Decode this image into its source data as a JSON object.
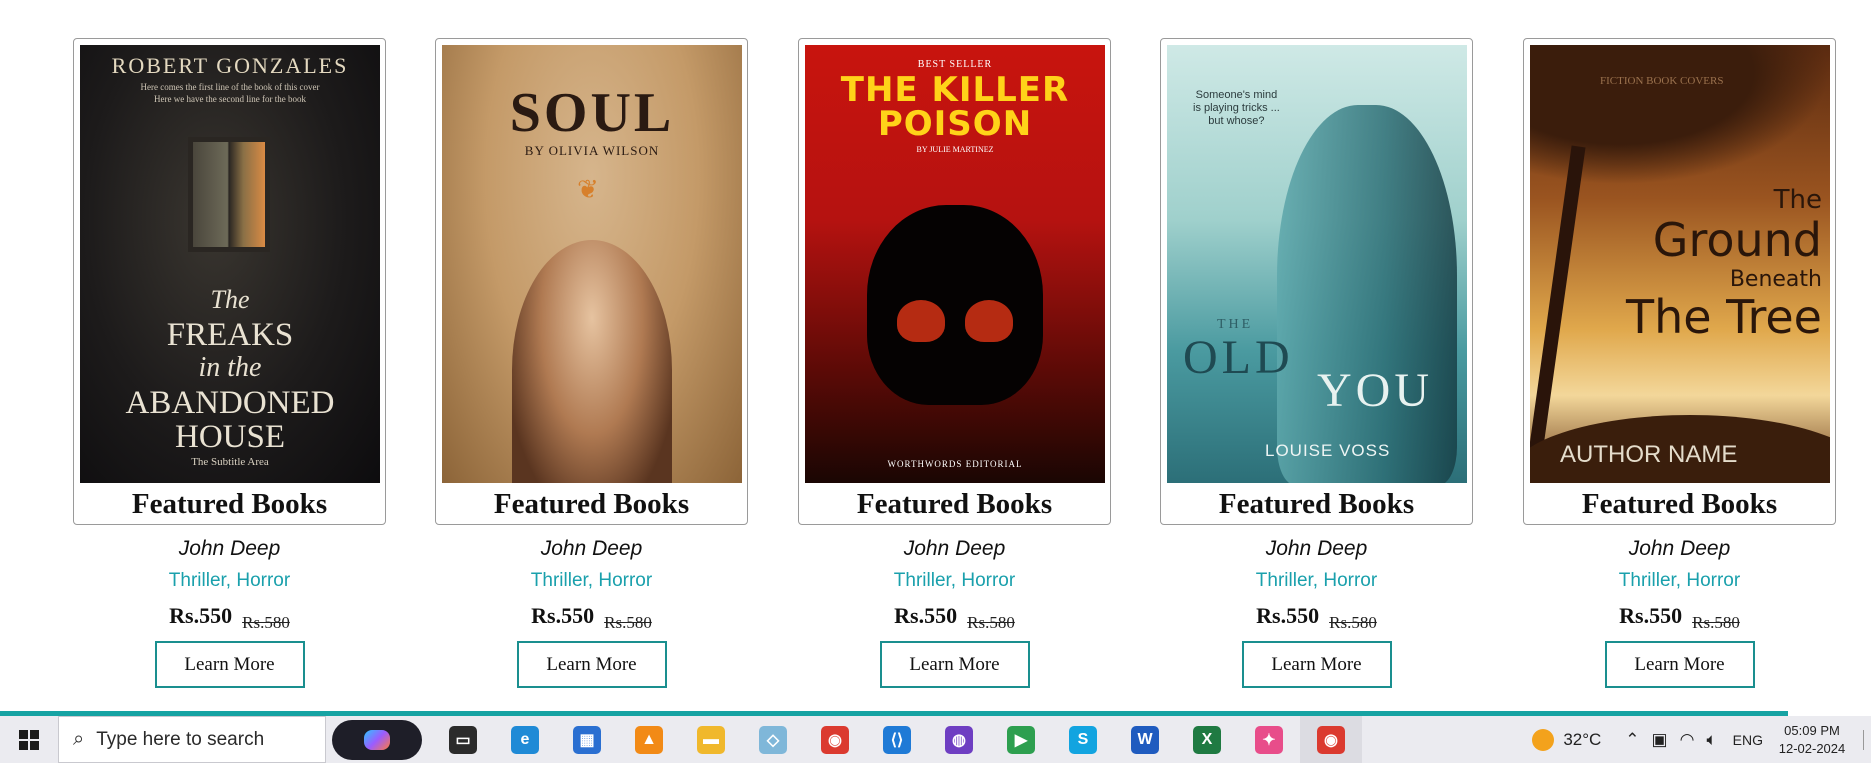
{
  "books": [
    {
      "heading": "Featured Books",
      "author": "John Deep",
      "genre": "Thriller, Horror",
      "price": "Rs.550",
      "old_price": "Rs.580",
      "button": "Learn More",
      "cover": {
        "author": "ROBERT GONZALES",
        "tagline_1": "Here comes the first line of the book of this cover",
        "tagline_2": "Here we have the second line for the book",
        "the": "The",
        "line_1": "FREAKS",
        "line_2": "in the",
        "line_3": "ABANDONED",
        "line_4": "HOUSE",
        "subtitle": "The Subtitle Area"
      }
    },
    {
      "heading": "Featured Books",
      "author": "John Deep",
      "genre": "Thriller, Horror",
      "price": "Rs.550",
      "old_price": "Rs.580",
      "button": "Learn More",
      "cover": {
        "title": "SOUL",
        "byline": "BY OLIVIA WILSON"
      }
    },
    {
      "heading": "Featured Books",
      "author": "John Deep",
      "genre": "Thriller, Horror",
      "price": "Rs.550",
      "old_price": "Rs.580",
      "button": "Learn More",
      "cover": {
        "badge": "BEST SELLER",
        "title_1": "THE KILLER",
        "title_2": "POISON",
        "byline": "BY JULIE MARTINEZ",
        "publisher": "WORTHWORDS EDITORIAL"
      }
    },
    {
      "heading": "Featured Books",
      "author": "John Deep",
      "genre": "Thriller, Horror",
      "price": "Rs.550",
      "old_price": "Rs.580",
      "button": "Learn More",
      "cover": {
        "quote_1": "Someone's mind",
        "quote_2": "is playing tricks ...",
        "quote_3": "but whose?",
        "the": "THE",
        "old": "OLD",
        "you": "YOU",
        "author": "LOUISE VOSS"
      }
    },
    {
      "heading": "Featured Books",
      "author": "John Deep",
      "genre": "Thriller, Horror",
      "price": "Rs.550",
      "old_price": "Rs.580",
      "button": "Learn More",
      "cover": {
        "the": "The",
        "ground": "Ground",
        "beneath": "Beneath",
        "tree": "The Tree",
        "author": "AUTHOR NAME",
        "watermark": "FICTION BOOK COVERS"
      }
    }
  ],
  "taskbar": {
    "search_placeholder": "Type here to search",
    "apps": [
      {
        "icon": "task-view-icon",
        "glyph": "▭",
        "color": "#2b2b2b"
      },
      {
        "icon": "edge-icon",
        "glyph": "e",
        "color": "#1f8ad6"
      },
      {
        "icon": "store-icon",
        "glyph": "▦",
        "color": "#2a6fd1"
      },
      {
        "icon": "vlc-icon",
        "glyph": "▲",
        "color": "#f28a16"
      },
      {
        "icon": "file-explorer-icon",
        "glyph": "▬",
        "color": "#f0b82c"
      },
      {
        "icon": "notes-icon",
        "glyph": "◇",
        "color": "#7fb7d9"
      },
      {
        "icon": "chrome-icon",
        "glyph": "◉",
        "color": "#db3a2f"
      },
      {
        "icon": "vscode-icon",
        "glyph": "⟨⟩",
        "color": "#1f7ad6"
      },
      {
        "icon": "github-icon",
        "glyph": "◍",
        "color": "#6e3ec2"
      },
      {
        "icon": "meet-icon",
        "glyph": "▶",
        "color": "#2d9f4f"
      },
      {
        "icon": "skype-icon",
        "glyph": "S",
        "color": "#12a4e0"
      },
      {
        "icon": "word-icon",
        "glyph": "W",
        "color": "#1f5bbf"
      },
      {
        "icon": "excel-icon",
        "glyph": "X",
        "color": "#1f7a42"
      },
      {
        "icon": "photos-icon",
        "glyph": "✦",
        "color": "#e84d8a"
      },
      {
        "icon": "chrome-profile-icon",
        "glyph": "◉",
        "color": "#db3a2f",
        "active": true
      }
    ],
    "temperature": "32°C",
    "language": "ENG",
    "time": "05:09 PM",
    "date": "12-02-2024"
  }
}
